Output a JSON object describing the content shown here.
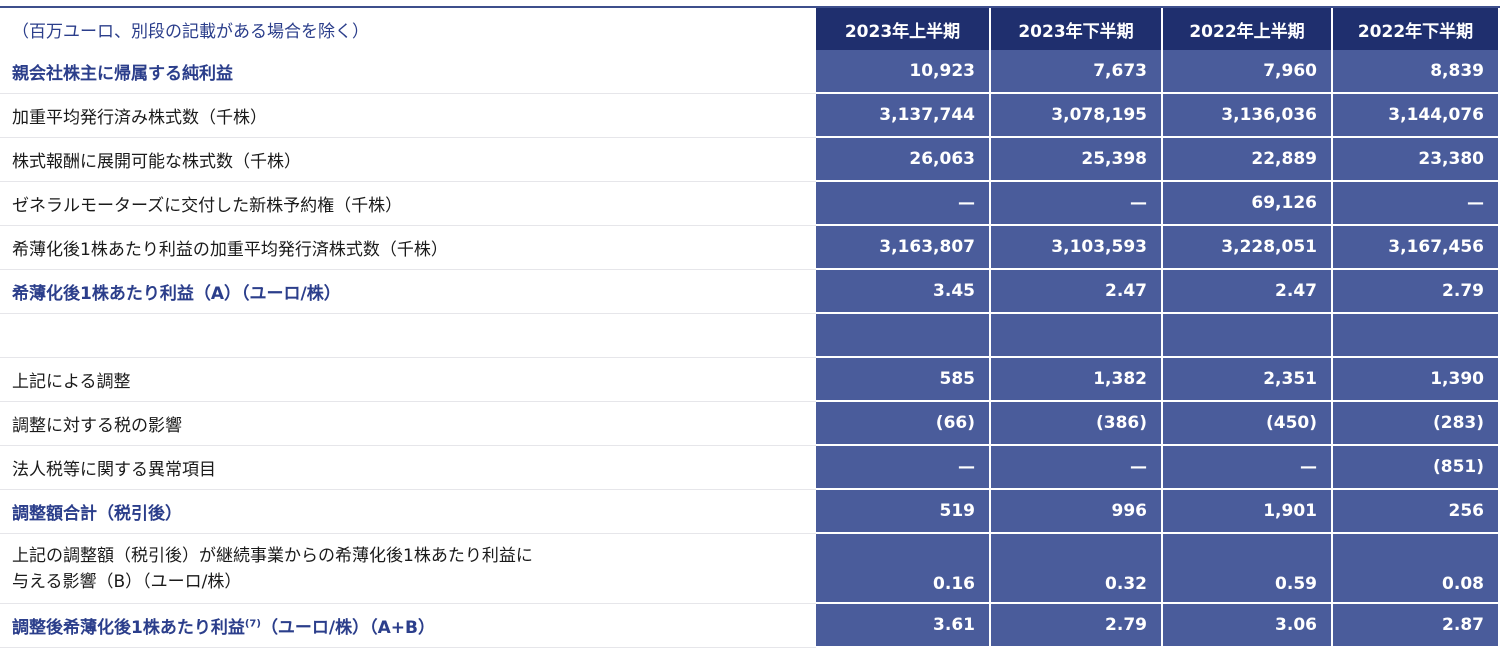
{
  "table": {
    "caption": "（百万ユーロ、別段の記載がある場合を除く）",
    "columns": [
      "2023年上半期",
      "2023年下半期",
      "2022年上半期",
      "2022年下半期"
    ],
    "rows": [
      {
        "label": "親会社株主に帰属する純利益",
        "values": [
          "10,923",
          "7,673",
          "7,960",
          "8,839"
        ]
      },
      {
        "label": "加重平均発行済み株式数（千株）",
        "values": [
          "3,137,744",
          "3,078,195",
          "3,136,036",
          "3,144,076"
        ]
      },
      {
        "label": "株式報酬に展開可能な株式数（千株）",
        "values": [
          "26,063",
          "25,398",
          "22,889",
          "23,380"
        ]
      },
      {
        "label": "ゼネラルモーターズに交付した新株予約権（千株）",
        "values": [
          "—",
          "—",
          "69,126",
          "—"
        ]
      },
      {
        "label": "希薄化後1株あたり利益の加重平均発行済株式数（千株）",
        "values": [
          "3,163,807",
          "3,103,593",
          "3,228,051",
          "3,167,456"
        ]
      },
      {
        "label": "希薄化後1株あたり利益（A）（ユーロ/株）",
        "values": [
          "3.45",
          "2.47",
          "2.47",
          "2.79"
        ]
      },
      {
        "label": "",
        "values": [
          "",
          "",
          "",
          ""
        ]
      },
      {
        "label": "上記による調整",
        "values": [
          "585",
          "1,382",
          "2,351",
          "1,390"
        ]
      },
      {
        "label": "調整に対する税の影響",
        "values": [
          "(66)",
          "(386)",
          "(450)",
          "(283)"
        ]
      },
      {
        "label": "法人税等に関する異常項目",
        "values": [
          "—",
          "—",
          "—",
          "(851)"
        ]
      },
      {
        "label": "調整額合計（税引後）",
        "values": [
          "519",
          "996",
          "1,901",
          "256"
        ]
      },
      {
        "label_line1": "上記の調整額（税引後）が継続事業からの希薄化後1株あたり利益に",
        "label_line2": "与える影響（B）（ユーロ/株）",
        "values": [
          "0.16",
          "0.32",
          "0.59",
          "0.08"
        ]
      },
      {
        "label_pre": "調整後希薄化後1株あたり利益",
        "label_sup": "(7)",
        "label_post": "（ユーロ/株）（A+B）",
        "values": [
          "3.61",
          "2.79",
          "3.06",
          "2.87"
        ]
      }
    ]
  }
}
